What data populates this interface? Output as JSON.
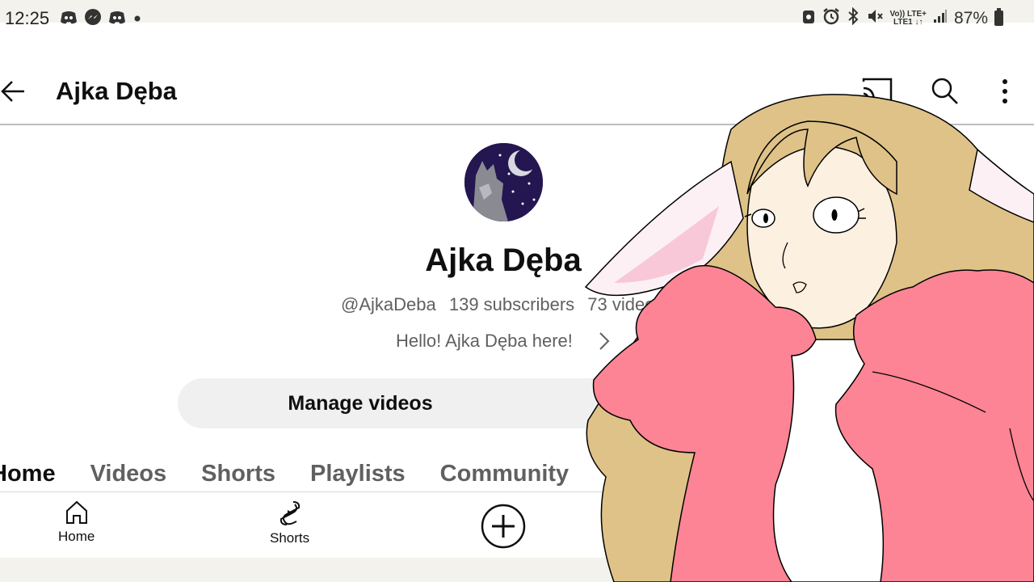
{
  "status_bar": {
    "time": "12:25",
    "battery": "87%",
    "network_top": "Vo)) LTE+",
    "network_bottom": "LTE1 ↓↑"
  },
  "app_bar": {
    "title": "Ajka Dęba"
  },
  "profile": {
    "name": "Ajka Dęba",
    "handle": "@AjkaDeba",
    "subscribers": "139 subscribers",
    "videos": "73 videos",
    "description": "Hello! Ajka Dęba here!",
    "manage_button": "Manage videos"
  },
  "tabs": [
    {
      "label": "Home",
      "active": true
    },
    {
      "label": "Videos",
      "active": false
    },
    {
      "label": "Shorts",
      "active": false
    },
    {
      "label": "Playlists",
      "active": false
    },
    {
      "label": "Community",
      "active": false
    }
  ],
  "bottom_nav": {
    "home": "Home",
    "shorts": "Shorts"
  },
  "colors": {
    "hair": "#dfc288",
    "coat": "#fc8494",
    "skin": "#fcf0e0",
    "ear_inner": "#f8c8d8",
    "avatar_bg": "#2a1a5e"
  },
  "icons": [
    "back-arrow-icon",
    "cast-icon",
    "search-icon",
    "more-vert-icon",
    "chevron-right-icon",
    "home-icon",
    "shorts-icon",
    "plus-circle-icon"
  ]
}
